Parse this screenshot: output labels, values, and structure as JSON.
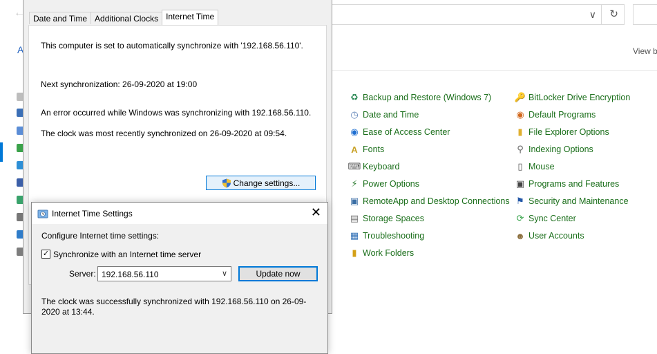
{
  "control_panel": {
    "header_partial": "A",
    "view_by_partial": "View b",
    "items": [
      {
        "label": "Backup and Restore (Windows 7)",
        "icon": "backup-icon"
      },
      {
        "label": "BitLocker Drive Encryption",
        "icon": "bitlocker-icon"
      },
      {
        "label": "Date and Time",
        "icon": "clock-icon"
      },
      {
        "label": "Default Programs",
        "icon": "default-programs-icon"
      },
      {
        "label": "Ease of Access Center",
        "icon": "ease-of-access-icon"
      },
      {
        "label": "File Explorer Options",
        "icon": "folder-options-icon"
      },
      {
        "label": "Fonts",
        "icon": "fonts-icon"
      },
      {
        "label": "Indexing Options",
        "icon": "indexing-icon"
      },
      {
        "label": "Keyboard",
        "icon": "keyboard-icon"
      },
      {
        "label": "Mouse",
        "icon": "mouse-icon"
      },
      {
        "label": "Power Options",
        "icon": "power-icon"
      },
      {
        "label": "Programs and Features",
        "icon": "programs-icon"
      },
      {
        "label": "RemoteApp and Desktop Connections",
        "icon": "remoteapp-icon"
      },
      {
        "label": "Security and Maintenance",
        "icon": "flag-icon"
      },
      {
        "label": "Storage Spaces",
        "icon": "storage-icon"
      },
      {
        "label": "Sync Center",
        "icon": "sync-icon"
      },
      {
        "label": "Troubleshooting",
        "icon": "troubleshooting-icon"
      },
      {
        "label": "User Accounts",
        "icon": "users-icon"
      },
      {
        "label": "Work Folders",
        "icon": "work-folders-icon"
      }
    ]
  },
  "date_time_dialog": {
    "tabs": [
      "Date and Time",
      "Additional Clocks",
      "Internet Time"
    ],
    "active_tab": "Internet Time",
    "auto_sync_text": "This computer is set to automatically synchronize with '192.168.56.110'.",
    "next_sync_text": "Next synchronization: 26-09-2020 at 19:00",
    "error_text": "An error occurred while Windows was synchronizing with 192.168.56.110.",
    "last_sync_text": "The clock was most recently synchronized on 26-09-2020 at 09:54.",
    "change_settings_label": "Change settings..."
  },
  "internet_time_settings": {
    "title": "Internet Time Settings",
    "configure_label": "Configure Internet time settings:",
    "sync_checkbox_label": "Synchronize with an Internet time server",
    "sync_checked": true,
    "server_label": "Server:",
    "server_value": "192.168.56.110",
    "update_now_label": "Update now",
    "status_text": "The clock was successfully synchronized with 192.168.56.110 on 26-09-2020 at 13:44."
  },
  "colors": {
    "link_green": "#1a6e1a",
    "accent_blue": "#0078d7",
    "dialog_bg": "#f0f0f0"
  }
}
